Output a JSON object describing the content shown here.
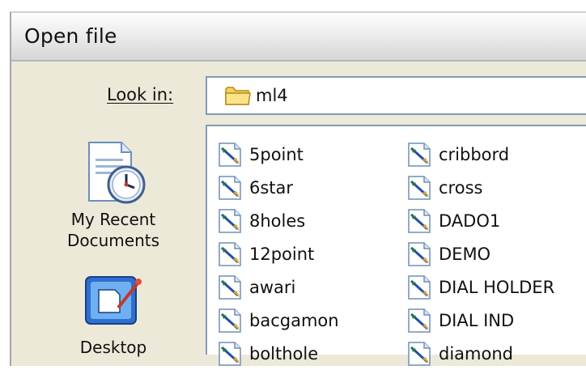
{
  "window": {
    "title": "Open file"
  },
  "lookin": {
    "label": "Look in:",
    "value": "ml4",
    "icon": "folder-icon"
  },
  "places": [
    {
      "label_lines": [
        "My Recent",
        "Documents"
      ],
      "icon": "recent-documents-icon"
    },
    {
      "label_lines": [
        "Desktop"
      ],
      "icon": "desktop-icon"
    }
  ],
  "files": {
    "column1": [
      "5point",
      "6star",
      "8holes",
      "12point",
      "awari",
      "bacgamon",
      "bolthole"
    ],
    "column2": [
      "cribbord",
      "cross",
      "DADO1",
      "DEMO",
      "DIAL HOLDER",
      "DIAL IND",
      "diamond"
    ],
    "icon": "drawing-file-icon"
  }
}
